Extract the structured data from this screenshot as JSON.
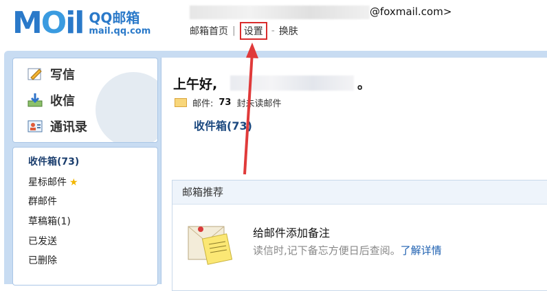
{
  "header": {
    "logo_mail": "M",
    "logo_mail2": "il",
    "logo_cn": "QQ邮箱",
    "logo_domain": "mail.qq.com",
    "account_suffix": "@foxmail.com>",
    "links": {
      "home": "邮箱首页",
      "sep": "|",
      "settings": "设置",
      "dash": "-",
      "skin": "换肤"
    }
  },
  "quick": {
    "write": "写信",
    "receive": "收信",
    "contacts": "通讯录"
  },
  "folders": [
    {
      "label": "收件箱(73)"
    },
    {
      "label": "星标邮件"
    },
    {
      "label": "群邮件"
    },
    {
      "label": "草稿箱(1)"
    },
    {
      "label": "已发送"
    },
    {
      "label": "已删除"
    }
  ],
  "main": {
    "greeting": "上午好,",
    "greeting_end": "。",
    "unread_prefix": "邮件:",
    "unread_count": "73",
    "unread_suffix": "封未读邮件",
    "inbox_link": "收件箱(73)",
    "rec_header": "邮箱推荐",
    "rec_title": "给邮件添加备注",
    "rec_desc": "读信时,记下备忘方便日后查阅。",
    "rec_link": "了解详情"
  },
  "colors": {
    "brand": "#2a79c9",
    "highlight": "#d92b2b",
    "frame": "#c8dcf2"
  }
}
